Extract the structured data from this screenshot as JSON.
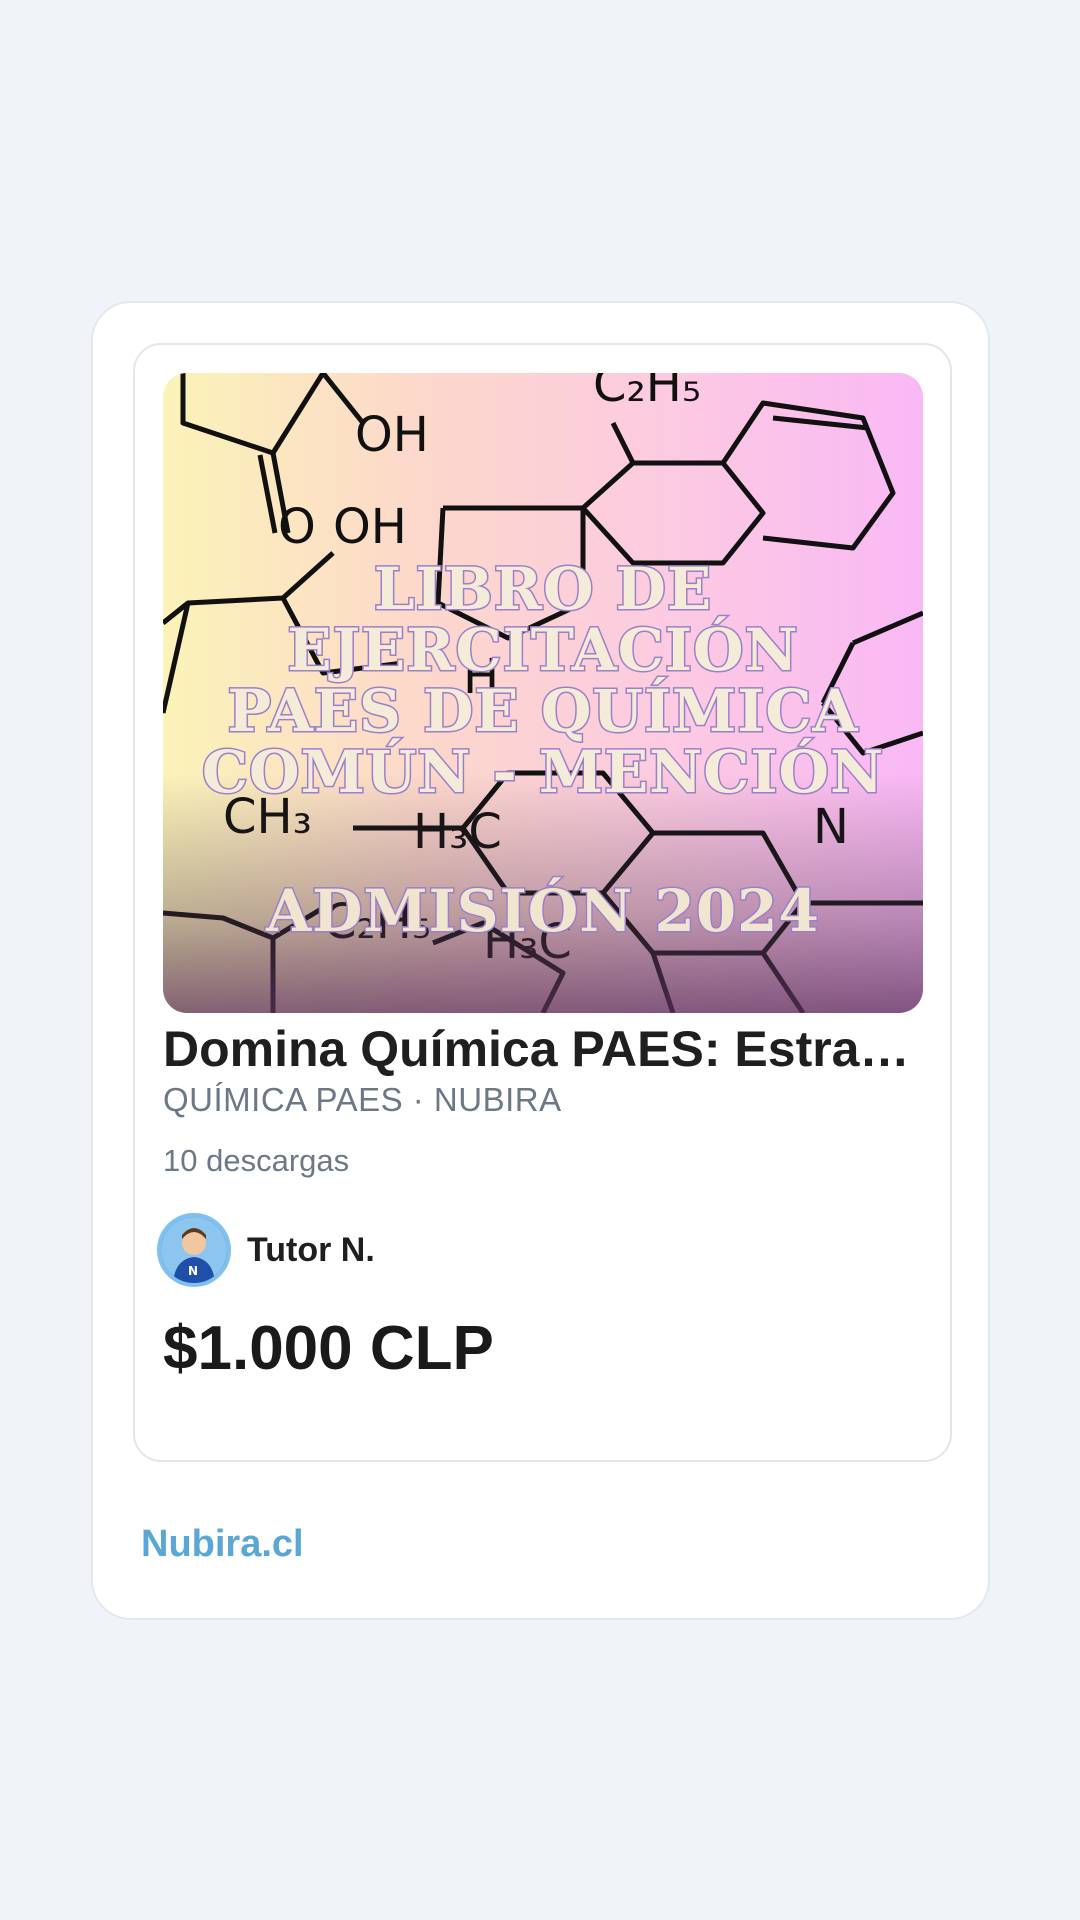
{
  "cover": {
    "title_lines": "LIBRO DE\nEJERCITACIÓN\nPAES DE QUÍMICA\nCOMÚN - MENCIÓN",
    "subtitle": "ADMISIÓN 2024"
  },
  "product": {
    "title": "Domina Química PAES: Estrategias...",
    "category": "QUÍMICA PAES · NUBIRA",
    "downloads": "10 descargas",
    "author": "Tutor N.",
    "price": "$1.000 CLP"
  },
  "footer": {
    "brand": "Nubira.cl"
  },
  "colors": {
    "brand": "#5aa7d6",
    "background": "#f0f4f8"
  }
}
